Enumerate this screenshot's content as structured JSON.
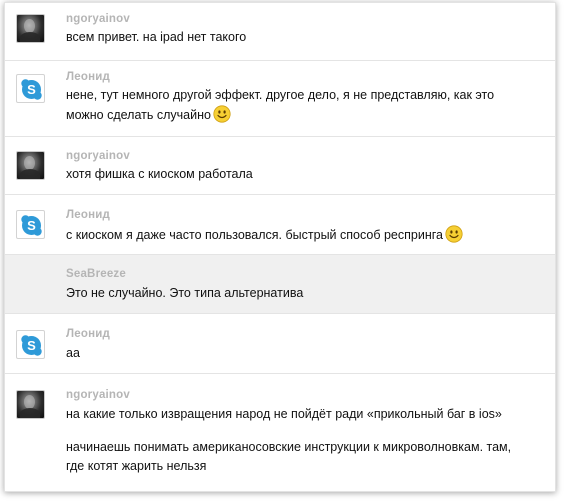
{
  "messages": [
    {
      "sender": "ngoryainov",
      "avatar": "user-photo-avatar",
      "lines": [
        "всем привет. на ipad нет такого"
      ]
    },
    {
      "sender": "Леонид",
      "avatar": "skype-logo-avatar",
      "lines": [
        "нене, тут немного другой эффект. другое дело, я не представляю, как это",
        "можно сделать случайно"
      ],
      "emoticon": "smiley-icon"
    },
    {
      "sender": "ngoryainov",
      "avatar": "user-photo-avatar",
      "lines": [
        "хотя фишка с киоском работала"
      ]
    },
    {
      "sender": "Леонид",
      "avatar": "skype-logo-avatar",
      "lines": [
        "с киоском я даже часто пользовался. быстрый способ респринга"
      ],
      "emoticon": "smiley-icon"
    },
    {
      "sender": "SeaBreeze",
      "avatar": "none",
      "highlighted": true,
      "lines": [
        "Это не случайно. Это типа альтернатива"
      ]
    },
    {
      "sender": "Леонид",
      "avatar": "skype-logo-avatar",
      "lines": [
        "аа"
      ]
    },
    {
      "sender": "ngoryainov",
      "avatar": "user-photo-avatar",
      "lines": [
        "на какие только извращения народ не пойдёт ради «прикольный баг в ios»"
      ]
    },
    {
      "sender": "",
      "avatar": "none",
      "continuation": true,
      "lines": [
        "начинаешь понимать американосовские инструкции к микроволновкам. там,",
        "где котят жарить нельзя"
      ]
    }
  ],
  "colors": {
    "sender_name": "#b5b5b5",
    "message_text": "#111111",
    "divider": "#e4e4e4",
    "highlight_row": "#f0f0f0",
    "skype_blue": "#2e9ad8",
    "smiley_yellow": "#f6cf33"
  }
}
